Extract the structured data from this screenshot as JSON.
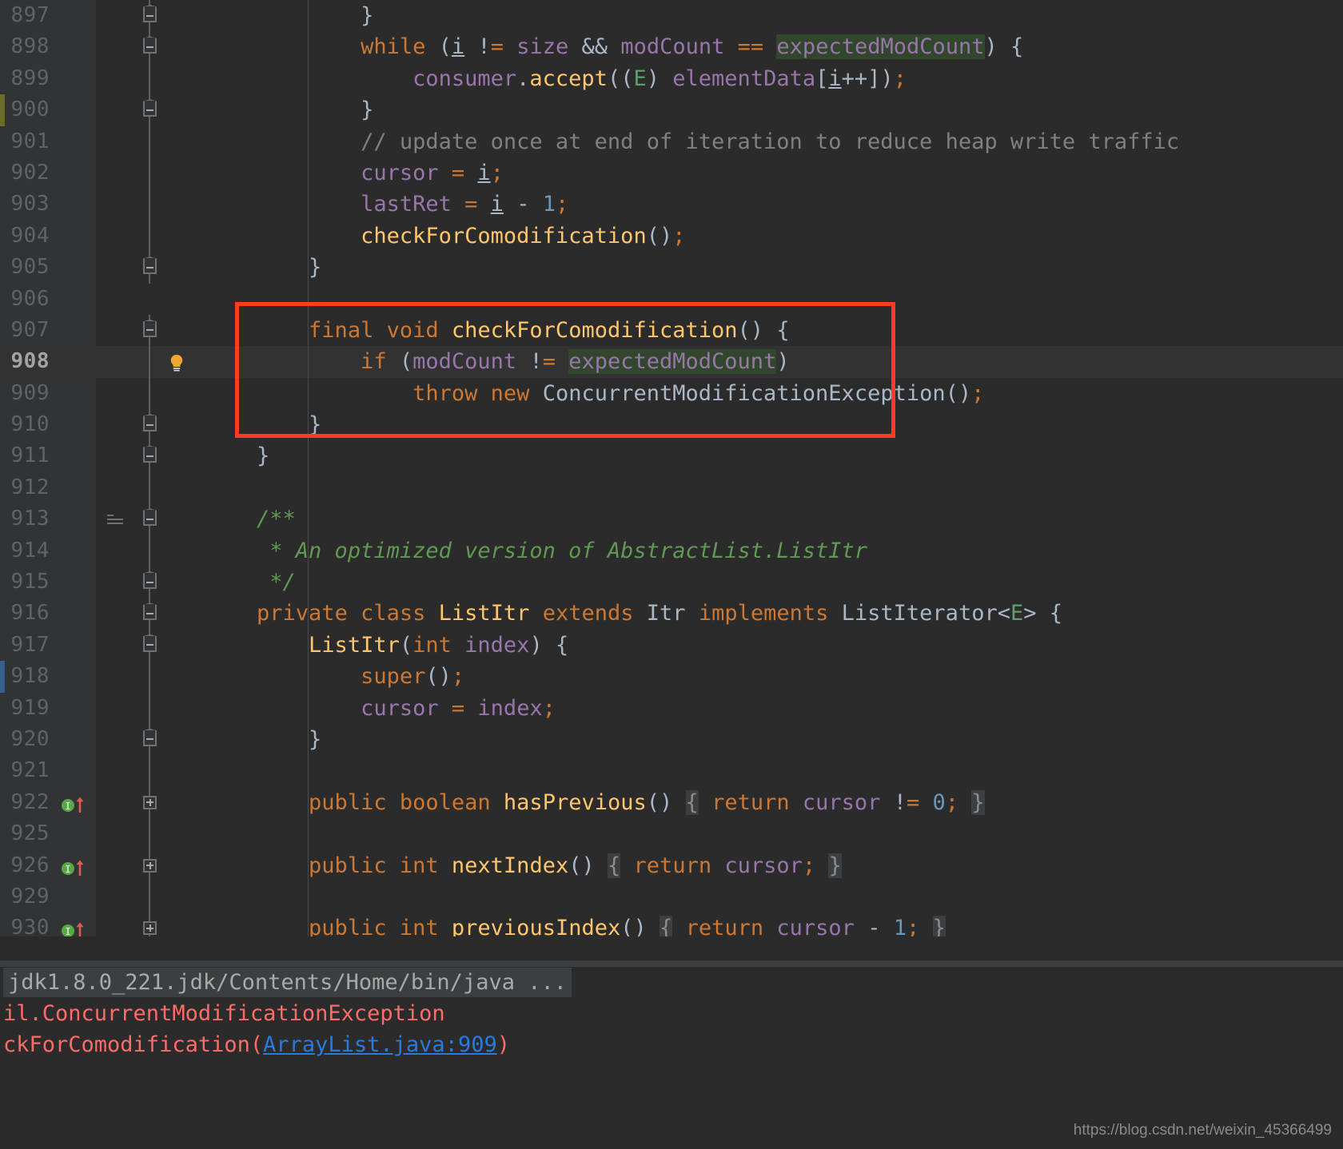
{
  "app": {
    "theme_bg": "#2b2b2b",
    "gutter_bg": "#313335",
    "accent_keyword": "#cc7832",
    "accent_field": "#9876aa",
    "accent_method": "#ffc66d",
    "accent_comment": "#808080",
    "accent_doc": "#629755",
    "accent_number": "#6897bb",
    "accent_error": "#ff6b68",
    "accent_link": "#287bde",
    "annotation_box_color": "#ff3b20",
    "search_highlight": "#32462e"
  },
  "editor": {
    "file": "ArrayList.java",
    "current_line": "908",
    "lines": [
      {
        "num": "897",
        "fold": "top-minus",
        "text": "            }"
      },
      {
        "num": "898",
        "fold": "mid-minus-arrow",
        "text": "            while (i != size && modCount == expectedModCount) {"
      },
      {
        "num": "899",
        "fold": "none",
        "text": "                consumer.accept((E) elementData[i++]);"
      },
      {
        "num": "900",
        "fold": "top-minus",
        "text": "            }"
      },
      {
        "num": "901",
        "fold": "none",
        "text": "            // update once at end of iteration to reduce heap write traffic"
      },
      {
        "num": "902",
        "fold": "none",
        "text": "            cursor = i;"
      },
      {
        "num": "903",
        "fold": "none",
        "text": "            lastRet = i - 1;"
      },
      {
        "num": "904",
        "fold": "none",
        "text": "            checkForComodification();"
      },
      {
        "num": "905",
        "fold": "top-minus",
        "text": "        }"
      },
      {
        "num": "906",
        "fold": "none",
        "text": ""
      },
      {
        "num": "907",
        "fold": "mid-minus",
        "text": "        final void checkForComodification() {"
      },
      {
        "num": "908",
        "fold": "none",
        "text": "            if (modCount != expectedModCount)",
        "bulb": true
      },
      {
        "num": "909",
        "fold": "none",
        "text": "                throw new ConcurrentModificationException();"
      },
      {
        "num": "910",
        "fold": "top-minus",
        "text": "        }"
      },
      {
        "num": "911",
        "fold": "top-minus",
        "text": "    }"
      },
      {
        "num": "912",
        "fold": "none",
        "text": ""
      },
      {
        "num": "913",
        "fold": "mid-minus",
        "text": "    /**",
        "struct_marker": true
      },
      {
        "num": "914",
        "fold": "none",
        "text": "     * An optimized version of AbstractList.ListItr"
      },
      {
        "num": "915",
        "fold": "top-minus",
        "text": "     */"
      },
      {
        "num": "916",
        "fold": "mid-minus",
        "text": "    private class ListItr extends Itr implements ListIterator<E> {"
      },
      {
        "num": "917",
        "fold": "mid-minus",
        "text": "        ListItr(int index) {"
      },
      {
        "num": "918",
        "fold": "none",
        "text": "            super();"
      },
      {
        "num": "919",
        "fold": "none",
        "text": "            cursor = index;"
      },
      {
        "num": "920",
        "fold": "top-minus",
        "text": "        }"
      },
      {
        "num": "921",
        "fold": "none",
        "text": ""
      },
      {
        "num": "922",
        "fold": "plus",
        "text": "        public boolean hasPrevious() { return cursor != 0; }",
        "impl_marker": true
      },
      {
        "num": "925",
        "fold": "none",
        "text": ""
      },
      {
        "num": "926",
        "fold": "plus",
        "text": "        public int nextIndex() { return cursor; }",
        "impl_marker": true
      },
      {
        "num": "929",
        "fold": "none",
        "text": ""
      },
      {
        "num": "930",
        "fold": "plus",
        "text": "        public int previousIndex() { return cursor - 1; }",
        "impl_marker": true
      }
    ]
  },
  "console": {
    "lines": [
      {
        "kind": "path",
        "text": "jdk1.8.0_221.jdk/Contents/Home/bin/java ..."
      },
      {
        "kind": "error",
        "text": "il.ConcurrentModificationException"
      },
      {
        "kind": "error_link",
        "prefix": "ckForComodification(",
        "link": "ArrayList.java:909",
        "suffix": ")"
      }
    ]
  },
  "watermark": {
    "text": "https://blog.csdn.net/weixin_45366499"
  },
  "icons": {
    "bulb": "lightbulb-icon",
    "implementing": "implementing-method-icon",
    "fold_collapse": "fold-collapse-icon",
    "fold_expand": "fold-expand-icon",
    "structure": "structure-marker-icon"
  }
}
